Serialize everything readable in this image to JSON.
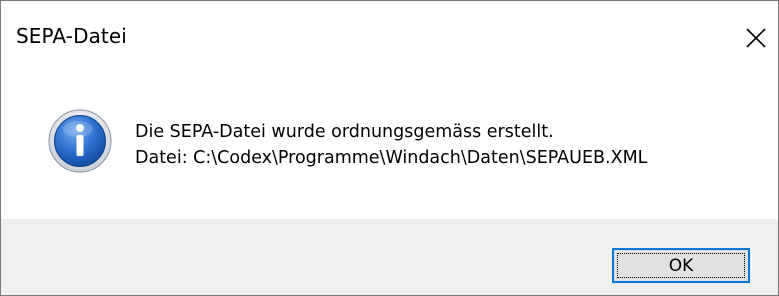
{
  "window": {
    "title": "SEPA-Datei",
    "close_icon": "close-icon"
  },
  "message": {
    "icon": "info-icon",
    "line1": "Die SEPA-Datei wurde ordnungsgemäss erstellt.",
    "line2": "Datei: C:\\Codex\\Programme\\Windach\\Daten\\SEPAUEB.XML"
  },
  "buttons": {
    "ok_label": "OK"
  },
  "colors": {
    "accent": "#0078d7",
    "footer_bg": "#f0f0f0",
    "button_bg": "#e1e1e1",
    "info_blue": "#1e5fb4"
  }
}
